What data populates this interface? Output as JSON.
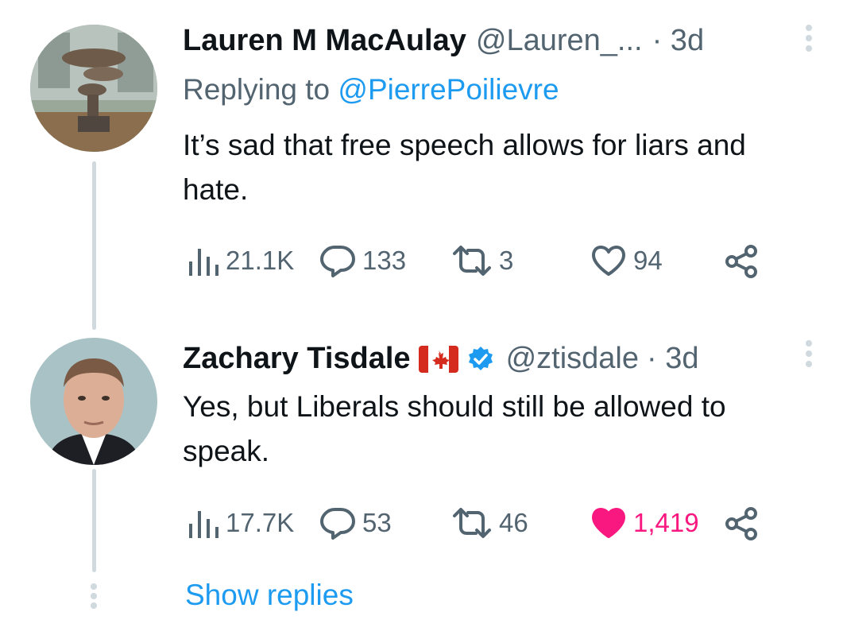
{
  "tweets": [
    {
      "name": "Lauren M MacAulay",
      "handle": "@Lauren_...",
      "time": "· 3d",
      "replying_prefix": "Replying to ",
      "replying_to": "@PierrePoilievre",
      "text": "It’s sad that free speech allows for liars and hate.",
      "stats": {
        "views": "21.1K",
        "replies": "133",
        "retweets": "3",
        "likes": "94"
      },
      "liked": false
    },
    {
      "name": "Zachary Tisdale",
      "handle": "@ztisdale",
      "time": "· 3d",
      "text": "Yes, but Liberals should still be allowed to speak.",
      "stats": {
        "views": "17.7K",
        "replies": "53",
        "retweets": "46",
        "likes": "1,419"
      },
      "liked": true
    }
  ],
  "show_replies": "Show replies",
  "icons": [
    "views-icon",
    "reply-icon",
    "retweet-icon",
    "like-icon",
    "share-icon",
    "more-icon",
    "verified-icon",
    "canada-flag-icon"
  ],
  "colors": {
    "accent": "#1d9bf0",
    "like": "#f91880",
    "muted": "#536471",
    "line": "#cfd9de"
  }
}
